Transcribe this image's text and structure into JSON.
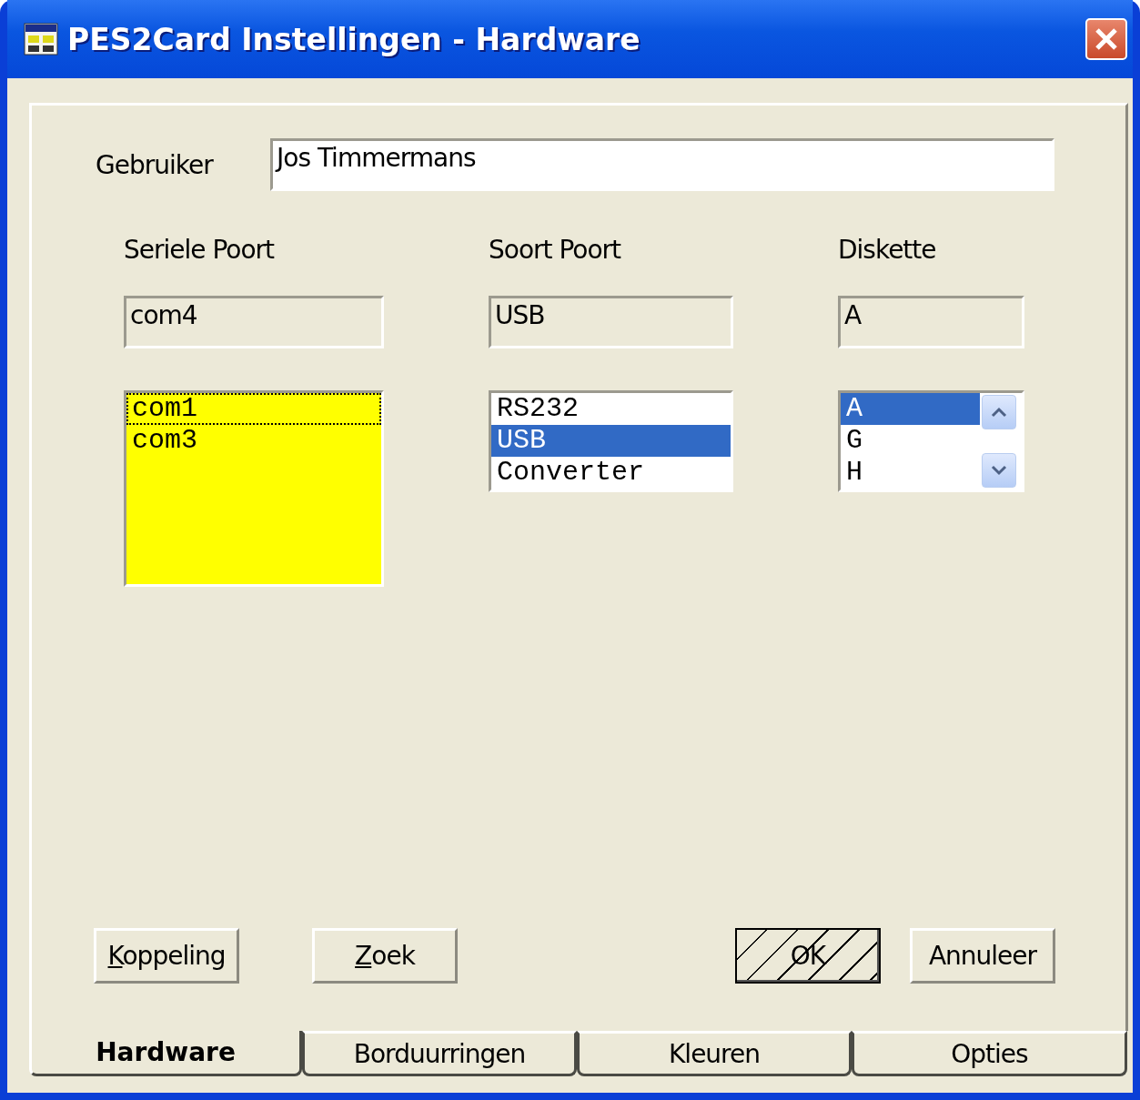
{
  "window": {
    "title": "PES2Card Instellingen - Hardware"
  },
  "user": {
    "label": "Gebruiker",
    "value": "Jos Timmermans"
  },
  "columns": [
    {
      "label": "Seriele Poort",
      "value": "com4",
      "list": {
        "kind": "highlight",
        "scrollbar": false,
        "items": [
          {
            "text": "com1",
            "selected": true
          },
          {
            "text": "com3",
            "selected": false
          }
        ]
      }
    },
    {
      "label": "Soort Poort",
      "value": "USB",
      "list": {
        "kind": "plain",
        "scrollbar": false,
        "items": [
          {
            "text": "RS232",
            "selected": false
          },
          {
            "text": "USB",
            "selected": true
          },
          {
            "text": "Converter",
            "selected": false
          }
        ]
      }
    },
    {
      "label": "Diskette",
      "value": "A",
      "list": {
        "kind": "plain",
        "scrollbar": true,
        "items": [
          {
            "text": "A",
            "selected": true
          },
          {
            "text": "G",
            "selected": false
          },
          {
            "text": "H",
            "selected": false
          }
        ]
      }
    }
  ],
  "buttons": [
    {
      "label": "Koppeling",
      "underline_first": true,
      "hatched": false
    },
    {
      "label": "Zoek",
      "underline_first": true,
      "hatched": false
    },
    {
      "label": "OK",
      "underline_first": false,
      "hatched": true
    },
    {
      "label": "Annuleer",
      "underline_first": false,
      "hatched": false
    }
  ],
  "tabs": [
    {
      "label": "Hardware",
      "selected": true
    },
    {
      "label": "Borduurringen",
      "selected": false
    },
    {
      "label": "Kleuren",
      "selected": false
    },
    {
      "label": "Opties",
      "selected": false
    }
  ]
}
